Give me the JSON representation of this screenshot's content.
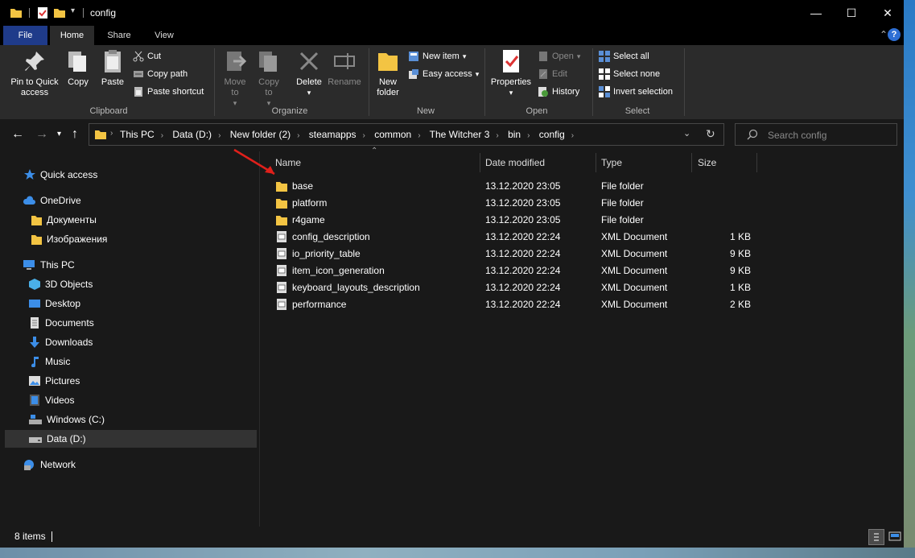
{
  "window": {
    "title": "config"
  },
  "tabs": {
    "file": "File",
    "home": "Home",
    "share": "Share",
    "view": "View"
  },
  "ribbon": {
    "clipboard": {
      "label": "Clipboard",
      "pin": "Pin to Quick access",
      "copy": "Copy",
      "paste": "Paste",
      "cut": "Cut",
      "copy_path": "Copy path",
      "paste_shortcut": "Paste shortcut"
    },
    "organize": {
      "label": "Organize",
      "move_to": "Move to",
      "copy_to": "Copy to",
      "delete": "Delete",
      "rename": "Rename"
    },
    "new": {
      "label": "New",
      "new_folder": "New folder",
      "new_item": "New item",
      "easy_access": "Easy access"
    },
    "open": {
      "label": "Open",
      "properties": "Properties",
      "open": "Open",
      "edit": "Edit",
      "history": "History"
    },
    "select": {
      "label": "Select",
      "select_all": "Select all",
      "select_none": "Select none",
      "invert": "Invert selection"
    }
  },
  "breadcrumb": [
    "This PC",
    "Data (D:)",
    "New folder (2)",
    "steamapps",
    "common",
    "The Witcher 3",
    "bin",
    "config"
  ],
  "search": {
    "placeholder": "Search config"
  },
  "nav": {
    "quick_access": "Quick access",
    "onedrive": "OneDrive",
    "documents_ru": "Документы",
    "images_ru": "Изображения",
    "this_pc": "This PC",
    "objects3d": "3D Objects",
    "desktop": "Desktop",
    "documents": "Documents",
    "downloads": "Downloads",
    "music": "Music",
    "pictures": "Pictures",
    "videos": "Videos",
    "windows_c": "Windows (C:)",
    "data_d": "Data (D:)",
    "network": "Network"
  },
  "columns": {
    "name": "Name",
    "date": "Date modified",
    "type": "Type",
    "size": "Size"
  },
  "files": [
    {
      "name": "base",
      "date": "13.12.2020 23:05",
      "type": "File folder",
      "size": "",
      "icon": "folder"
    },
    {
      "name": "platform",
      "date": "13.12.2020 23:05",
      "type": "File folder",
      "size": "",
      "icon": "folder"
    },
    {
      "name": "r4game",
      "date": "13.12.2020 23:05",
      "type": "File folder",
      "size": "",
      "icon": "folder"
    },
    {
      "name": "config_description",
      "date": "13.12.2020 22:24",
      "type": "XML Document",
      "size": "1 KB",
      "icon": "xml"
    },
    {
      "name": "io_priority_table",
      "date": "13.12.2020 22:24",
      "type": "XML Document",
      "size": "9 KB",
      "icon": "xml"
    },
    {
      "name": "item_icon_generation",
      "date": "13.12.2020 22:24",
      "type": "XML Document",
      "size": "9 KB",
      "icon": "xml"
    },
    {
      "name": "keyboard_layouts_description",
      "date": "13.12.2020 22:24",
      "type": "XML Document",
      "size": "1 KB",
      "icon": "xml"
    },
    {
      "name": "performance",
      "date": "13.12.2020 22:24",
      "type": "XML Document",
      "size": "2 KB",
      "icon": "xml"
    }
  ],
  "status": {
    "items": "8 items"
  },
  "colors": {
    "accent": "#1f3b8a",
    "folder": "#f3c443",
    "annotation_arrow": "#e0201b"
  }
}
